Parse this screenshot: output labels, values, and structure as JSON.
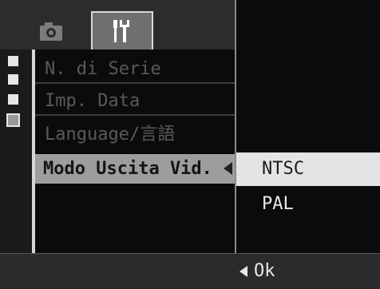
{
  "tabs": [
    {
      "icon": "camera-icon"
    },
    {
      "icon": "setup-icon"
    }
  ],
  "menu": {
    "items": [
      {
        "label": "N. di Serie"
      },
      {
        "label": "Imp. Data"
      },
      {
        "label": "Language/言語"
      },
      {
        "label": "Modo Uscita Vid."
      }
    ]
  },
  "submenu": {
    "options": [
      {
        "label": "NTSC"
      },
      {
        "label": "PAL"
      }
    ]
  },
  "footer": {
    "ok_label": "Ok"
  },
  "colors": {
    "selected_row": "#9d9d9d",
    "selected_option": "#e4e4e4",
    "background": "#0b0b0b"
  }
}
